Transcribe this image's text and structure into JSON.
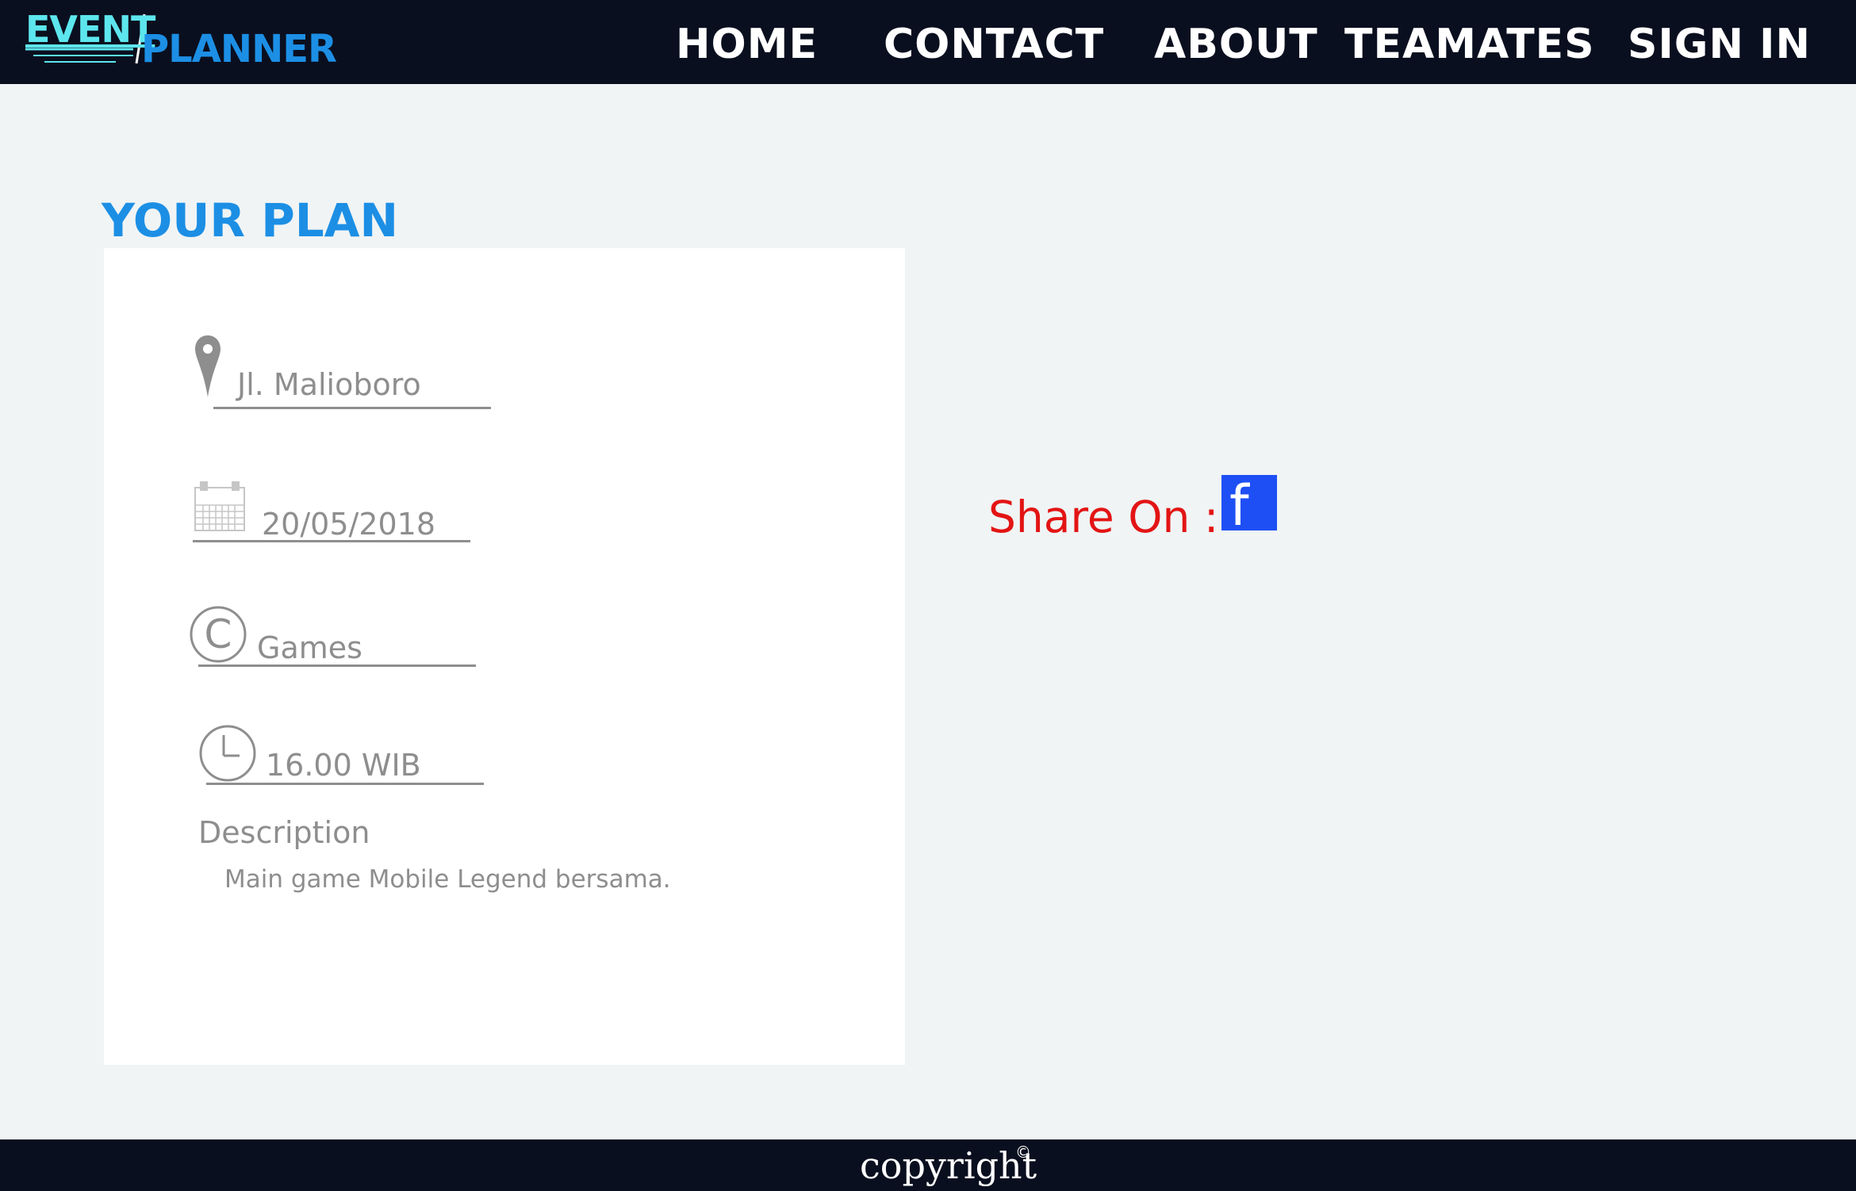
{
  "header": {
    "logo_primary": "EVENT",
    "logo_secondary": "PLANNER",
    "nav": [
      {
        "label": "HOME"
      },
      {
        "label": "CONTACT"
      },
      {
        "label": "ABOUT"
      },
      {
        "label": "TEAMATES"
      },
      {
        "label": "SIGN IN"
      }
    ]
  },
  "main": {
    "title": "YOUR PLAN",
    "plan": {
      "location": {
        "icon": "location-pin-icon",
        "value": "Jl. Malioboro"
      },
      "date": {
        "icon": "calendar-icon",
        "value": "20/05/2018"
      },
      "category": {
        "icon": "category-c-icon",
        "value": "Games"
      },
      "time": {
        "icon": "clock-icon",
        "value": "16.00 WIB"
      },
      "description_label": "Description",
      "description": "Main game Mobile Legend bersama."
    },
    "share": {
      "label": "Share On :",
      "facebook_glyph": "f",
      "facebook_icon": "facebook-icon"
    }
  },
  "footer": {
    "text": "copyright",
    "symbol": "©"
  },
  "colors": {
    "topbar": "#0a0f1f",
    "background": "#f0f4f5",
    "title_blue": "#1c8fe5",
    "logo_cyan": "#5de6ee",
    "share_red": "#e31414",
    "facebook_blue": "#1e4ff5",
    "muted_text": "#8e8e8e"
  }
}
